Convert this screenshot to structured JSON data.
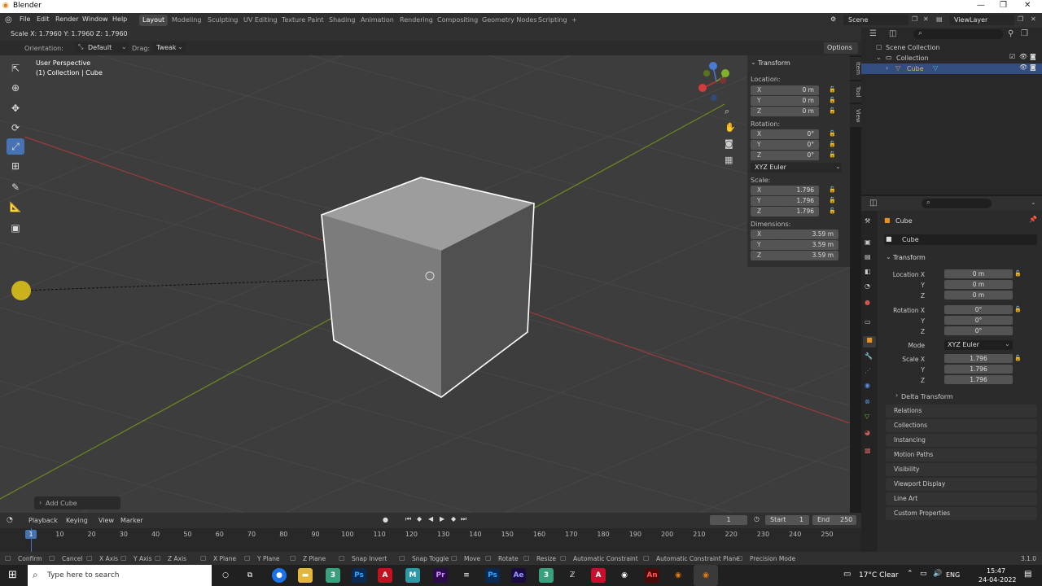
{
  "window": {
    "title": "Blender",
    "min": "—",
    "max": "❐",
    "close": "✕"
  },
  "menu": [
    "File",
    "Edit",
    "Render",
    "Window",
    "Help"
  ],
  "workspaces": [
    "Layout",
    "Modeling",
    "Sculpting",
    "UV Editing",
    "Texture Paint",
    "Shading",
    "Animation",
    "Rendering",
    "Compositing",
    "Geometry Nodes",
    "Scripting",
    "+"
  ],
  "scene": {
    "label": "Scene",
    "view_layer": "ViewLayer"
  },
  "header": {
    "scale_readout": "Scale X: 1.7960   Y: 1.7960   Z: 1.7960",
    "orientation_label": "Orientation:",
    "orientation_value": "Default",
    "drag_label": "Drag:",
    "drag_value": "Tweak",
    "options": "Options"
  },
  "viewport": {
    "perspective": "User Perspective",
    "collection": "(1) Collection | Cube",
    "last_op": "Add Cube"
  },
  "npanel": {
    "title": "Transform",
    "location_label": "Location:",
    "rotation_label": "Rotation:",
    "scale_label": "Scale:",
    "dimensions_label": "Dimensions:",
    "location": [
      {
        "k": "X",
        "v": "0 m"
      },
      {
        "k": "Y",
        "v": "0 m"
      },
      {
        "k": "Z",
        "v": "0 m"
      }
    ],
    "rotation": [
      {
        "k": "X",
        "v": "0°"
      },
      {
        "k": "Y",
        "v": "0°"
      },
      {
        "k": "Z",
        "v": "0°"
      }
    ],
    "rotation_mode": "XYZ Euler",
    "scale": [
      {
        "k": "X",
        "v": "1.796"
      },
      {
        "k": "Y",
        "v": "1.796"
      },
      {
        "k": "Z",
        "v": "1.796"
      }
    ],
    "dimensions": [
      {
        "k": "X",
        "v": "3.59 m"
      },
      {
        "k": "Y",
        "v": "3.59 m"
      },
      {
        "k": "Z",
        "v": "3.59 m"
      }
    ],
    "tabs": [
      "Item",
      "Tool",
      "View"
    ]
  },
  "outliner": {
    "scene_collection": "Scene Collection",
    "collection": "Collection",
    "object": "Cube"
  },
  "properties": {
    "object_name": "Cube",
    "datablock": "Cube",
    "section": "Transform",
    "location_labels": [
      "Location X",
      "Y",
      "Z"
    ],
    "location": [
      "0 m",
      "0 m",
      "0 m"
    ],
    "rotation_labels": [
      "Rotation X",
      "Y",
      "Z"
    ],
    "rotation": [
      "0°",
      "0°",
      "0°"
    ],
    "mode_label": "Mode",
    "mode_value": "XYZ Euler",
    "scale_labels": [
      "Scale X",
      "Y",
      "Z"
    ],
    "scale": [
      "1.796",
      "1.796",
      "1.796"
    ],
    "delta": "Delta Transform",
    "sections": [
      "Relations",
      "Collections",
      "Instancing",
      "Motion Paths",
      "Visibility",
      "Viewport Display",
      "Line Art",
      "Custom Properties"
    ]
  },
  "timeline": {
    "menus": [
      "Playback",
      "Keying",
      "View",
      "Marker"
    ],
    "frame": "1",
    "start_label": "Start",
    "start": "1",
    "end_label": "End",
    "end": "250",
    "ticks": [
      "1",
      "10",
      "20",
      "30",
      "40",
      "50",
      "60",
      "70",
      "80",
      "90",
      "100",
      "110",
      "120",
      "130",
      "140",
      "150",
      "160",
      "170",
      "180",
      "190",
      "200",
      "210",
      "220",
      "230",
      "240",
      "250"
    ]
  },
  "status": {
    "items": [
      "Confirm",
      "Cancel",
      "X Axis",
      "Y Axis",
      "Z Axis",
      "X Plane",
      "Y Plane",
      "Z Plane",
      "Snap Invert",
      "Snap Toggle",
      "Move",
      "Rotate",
      "Resize",
      "Automatic Constraint",
      "Automatic Constraint Plane",
      "Precision Mode"
    ],
    "version": "3.1.0"
  },
  "taskbar": {
    "search": "Type here to search",
    "weather": "17°C  Clear",
    "lang": "ENG",
    "time": "15:47",
    "date": "24-04-2022"
  }
}
